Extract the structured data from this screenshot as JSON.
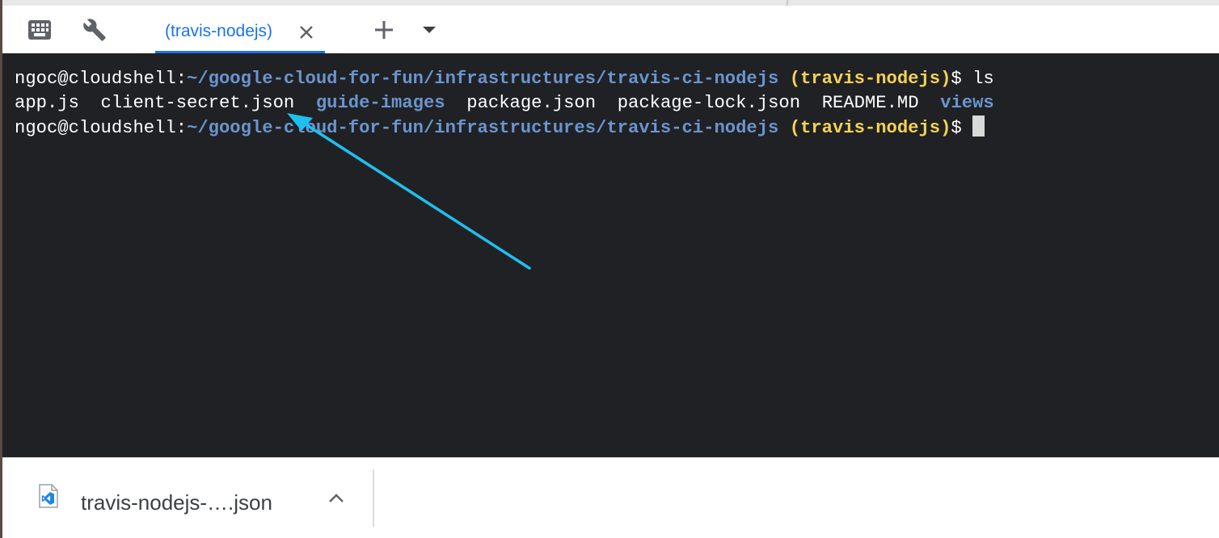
{
  "tabbar": {
    "active_tab_label": "(travis-nodejs)",
    "icons": [
      "keyboard-icon",
      "wrench-icon",
      "close-icon",
      "plus-icon",
      "dropdown-icon"
    ]
  },
  "terminal": {
    "lines": [
      {
        "prompt_user": "ngoc@cloudshell:",
        "prompt_path": "~/google-cloud-for-fun/infrastructures/travis-ci-nodejs",
        "prompt_project": "(travis-nodejs)",
        "prompt_symbol": "$ ",
        "command": "ls"
      },
      {
        "files": [
          "app.js",
          "client-secret.json",
          "guide-images",
          "package.json",
          "package-lock.json",
          "README.MD",
          "views"
        ],
        "directories": [
          "guide-images",
          "views"
        ]
      },
      {
        "prompt_user": "ngoc@cloudshell:",
        "prompt_path": "~/google-cloud-for-fun/infrastructures/travis-ci-nodejs",
        "prompt_project": "(travis-nodejs)",
        "prompt_symbol": "$ ",
        "command": ""
      }
    ]
  },
  "download_bar": {
    "file_name": "travis-nodejs-….json",
    "icons": [
      "vscode-file-icon",
      "chevron-up-icon"
    ]
  },
  "colors": {
    "accent": "#1a73e8",
    "terminal_bg": "#202124",
    "path": "#6a95cf",
    "project": "#f5d352",
    "arrow": "#1ec0f0"
  }
}
